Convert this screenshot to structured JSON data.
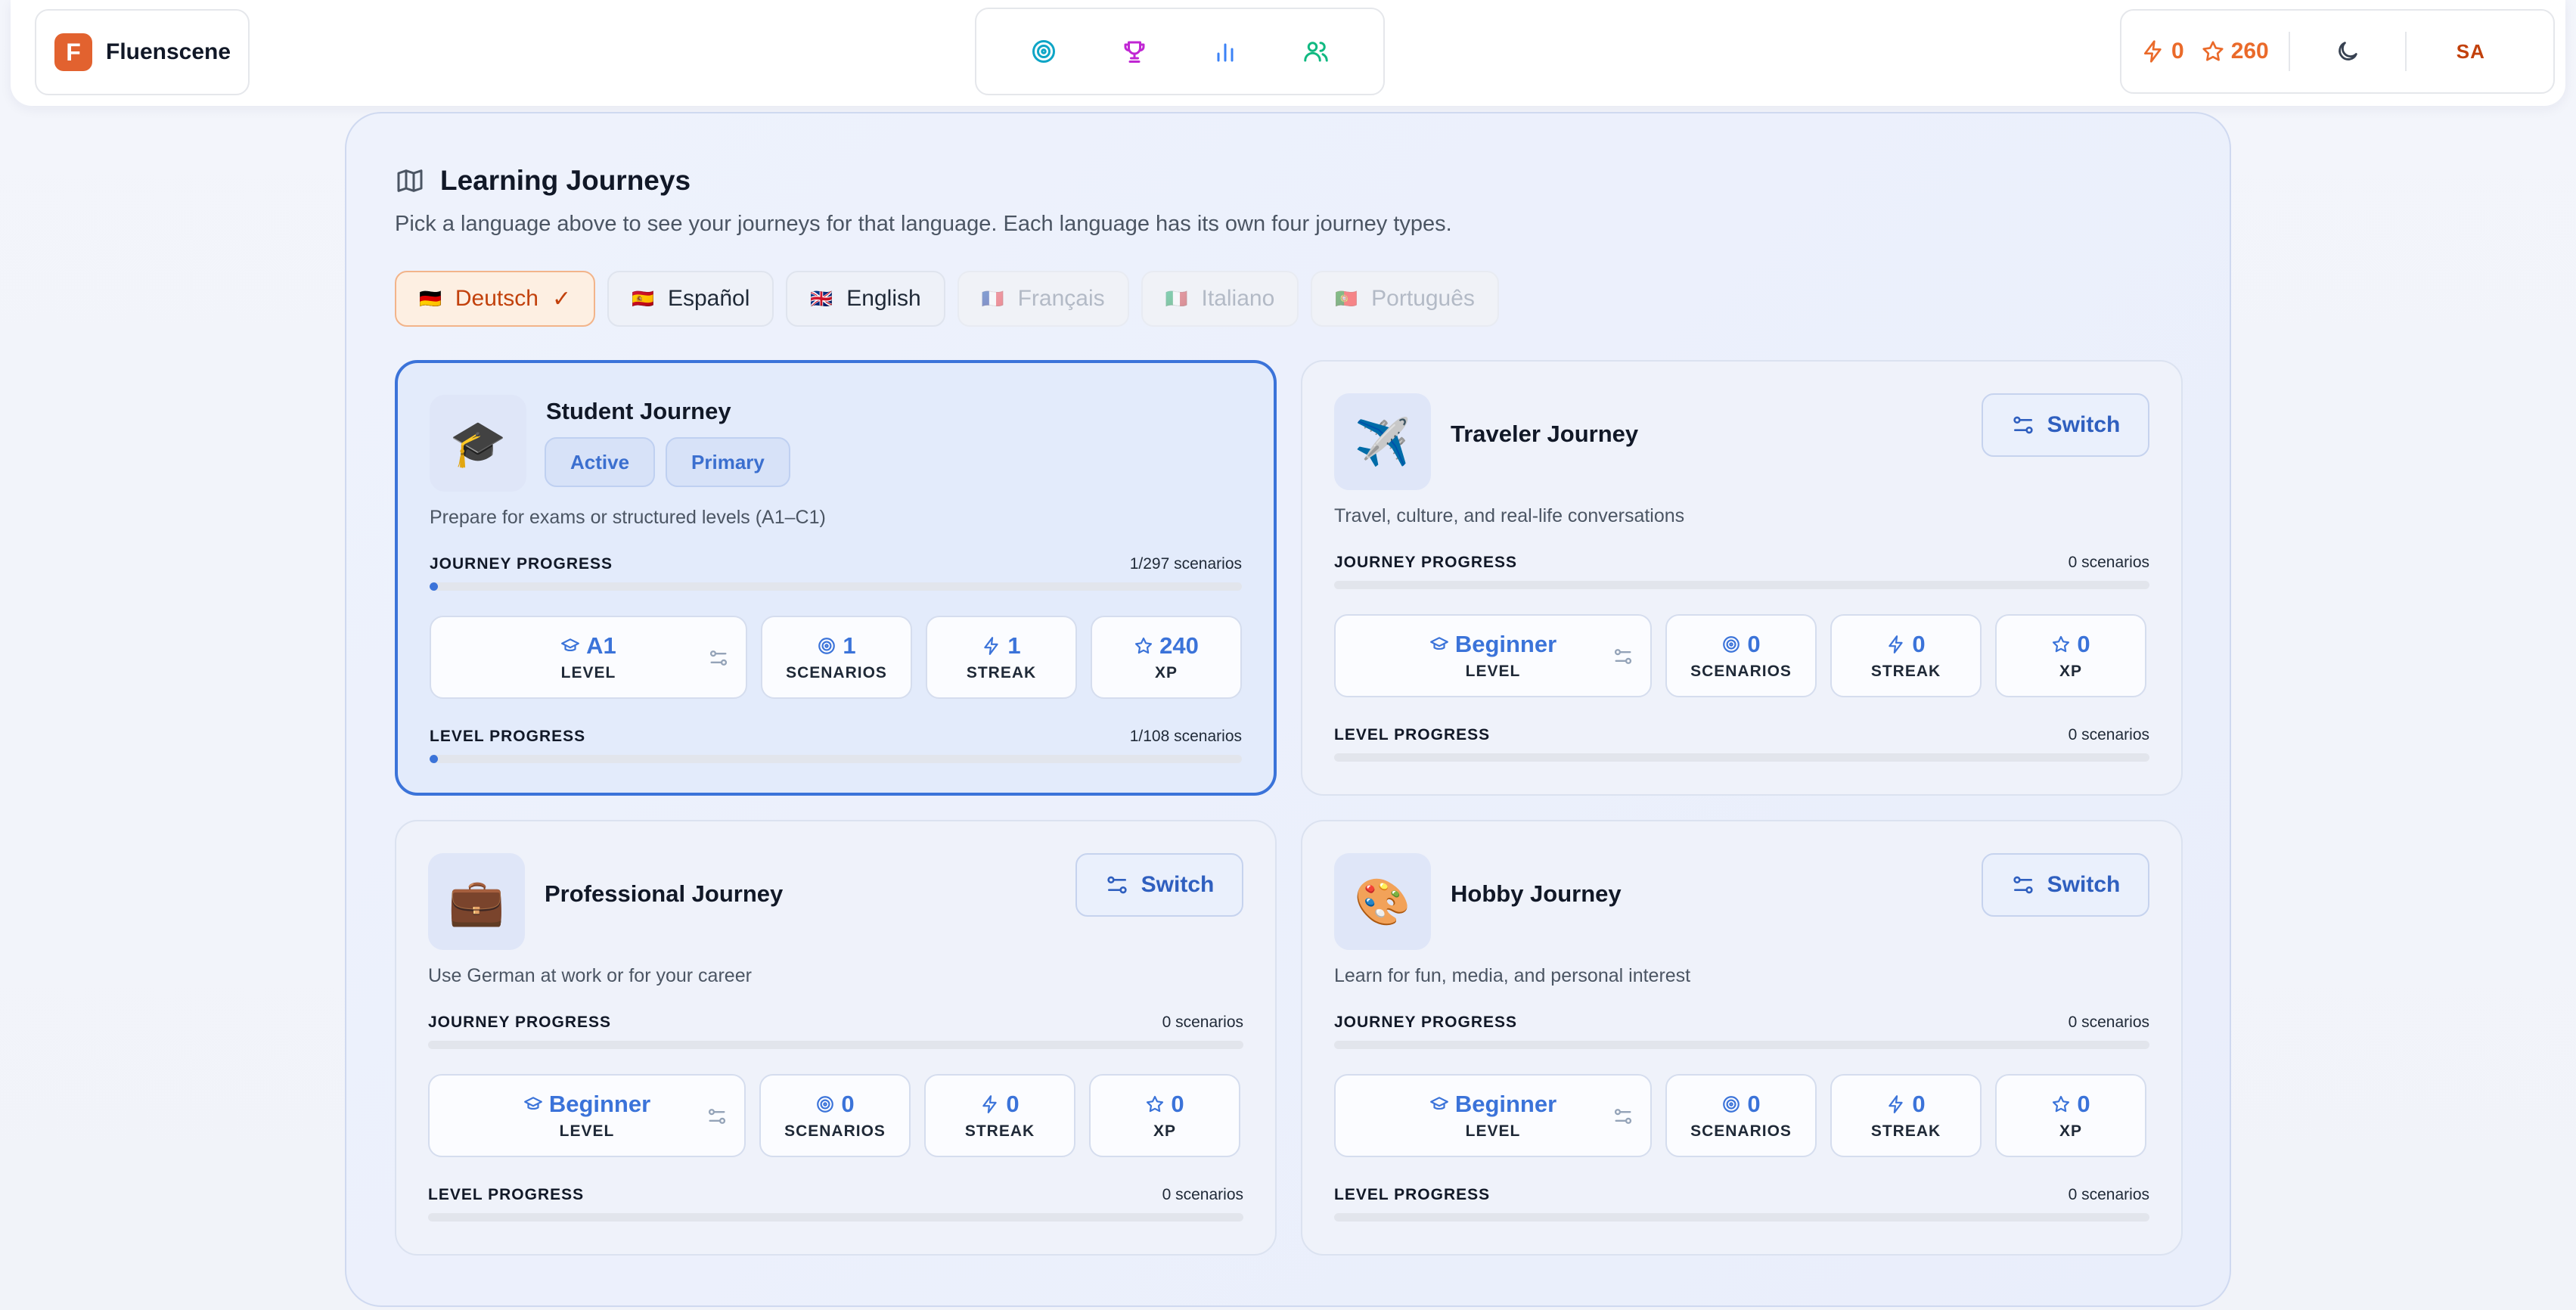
{
  "app": {
    "name": "Fluenscene",
    "logo_letter": "F"
  },
  "nav": [
    {
      "name": "scenarios",
      "icon": "target-icon",
      "color": "#0ea5c6"
    },
    {
      "name": "achievements",
      "icon": "trophy-icon",
      "color": "#c026d3"
    },
    {
      "name": "stats",
      "icon": "bar-chart-icon",
      "color": "#3b82f6"
    },
    {
      "name": "community",
      "icon": "users-icon",
      "color": "#10b981"
    }
  ],
  "header": {
    "streak": "0",
    "xp": "260",
    "avatar": "SA"
  },
  "panel": {
    "title": "Learning Journeys",
    "description": "Pick a language above to see your journeys for that language. Each language has its own four journey types."
  },
  "languages": [
    {
      "label": "Deutsch",
      "flag": "🇩🇪",
      "state": "active",
      "check": "✓"
    },
    {
      "label": "Español",
      "flag": "🇪🇸",
      "state": "enabled"
    },
    {
      "label": "English",
      "flag": "🇬🇧",
      "state": "enabled"
    },
    {
      "label": "Français",
      "flag": "🇫🇷",
      "state": "disabled"
    },
    {
      "label": "Italiano",
      "flag": "🇮🇹",
      "state": "disabled"
    },
    {
      "label": "Português",
      "flag": "🇵🇹",
      "state": "disabled"
    }
  ],
  "labels": {
    "journey_progress": "JOURNEY PROGRESS",
    "level_progress": "LEVEL PROGRESS",
    "level": "LEVEL",
    "scenarios": "SCENARIOS",
    "streak": "STREAK",
    "xp": "XP",
    "switch": "Switch"
  },
  "journeys": [
    {
      "title": "Student Journey",
      "emoji": "🎓",
      "description": "Prepare for exams or structured levels (A1–C1)",
      "badges": [
        "Active",
        "Primary"
      ],
      "journey_progress": "1/297 scenarios",
      "journey_fraction": 0.0034,
      "level": "A1",
      "scenarios": "1",
      "streak": "1",
      "xp": "240",
      "level_progress": "1/108 scenarios",
      "level_fraction": 0.0093
    },
    {
      "title": "Traveler Journey",
      "emoji": "✈️",
      "description": "Travel, culture, and real-life conversations",
      "journey_progress": "0 scenarios",
      "journey_fraction": 0,
      "level": "Beginner",
      "scenarios": "0",
      "streak": "0",
      "xp": "0",
      "level_progress": "0 scenarios",
      "level_fraction": 0
    },
    {
      "title": "Professional Journey",
      "emoji": "💼",
      "description": "Use German at work or for your career",
      "journey_progress": "0 scenarios",
      "journey_fraction": 0,
      "level": "Beginner",
      "scenarios": "0",
      "streak": "0",
      "xp": "0",
      "level_progress": "0 scenarios",
      "level_fraction": 0
    },
    {
      "title": "Hobby Journey",
      "emoji": "🎨",
      "description": "Learn for fun, media, and personal interest",
      "journey_progress": "0 scenarios",
      "journey_fraction": 0,
      "level": "Beginner",
      "scenarios": "0",
      "streak": "0",
      "xp": "0",
      "level_progress": "0 scenarios",
      "level_fraction": 0
    }
  ],
  "colors": {
    "accent": "#3b73d9",
    "brand": "#e2622f",
    "header_stat": "#ea6a2a"
  }
}
